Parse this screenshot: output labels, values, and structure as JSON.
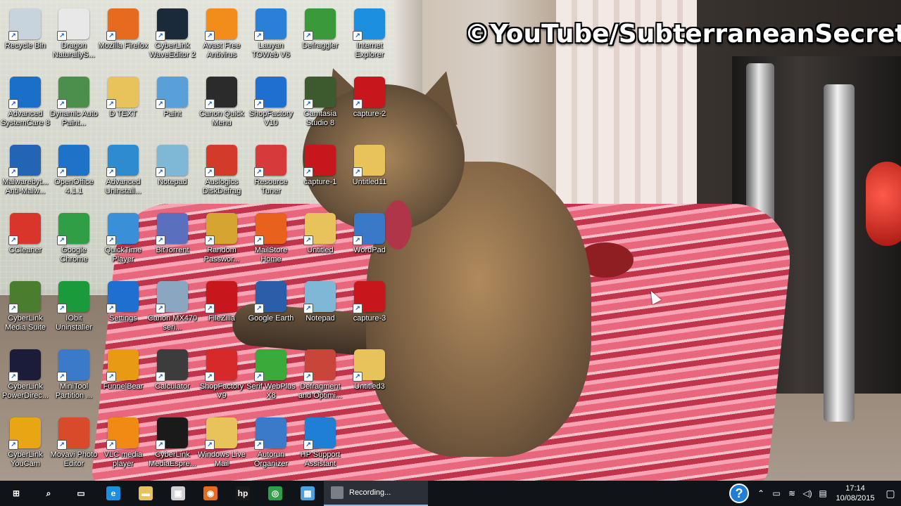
{
  "watermark": "©YouTube/SubterraneanSecret",
  "desktop_icons": [
    {
      "label": "Recycle Bin",
      "icon": "recycle-bin-icon",
      "color": "#c7d4de"
    },
    {
      "label": "Dragon NaturallyS...",
      "icon": "dragon-icon",
      "color": "#e8e8e8"
    },
    {
      "label": "Mozilla Firefox",
      "icon": "firefox-icon",
      "color": "#e66b1e"
    },
    {
      "label": "CyberLink WaveEditor 2",
      "icon": "waveeditor-icon",
      "color": "#1b2a3a"
    },
    {
      "label": "Avast Free Antivirus",
      "icon": "avast-icon",
      "color": "#f28c1a"
    },
    {
      "label": "Lauyan TOWeb V6",
      "icon": "toweb-icon",
      "color": "#2a7fd6"
    },
    {
      "label": "Defraggler",
      "icon": "defraggler-icon",
      "color": "#3a9a3a"
    },
    {
      "label": "Internet Explorer",
      "icon": "internet-explorer-icon",
      "color": "#1d8fe1"
    },
    {
      "label": "Advanced SystemCare 8",
      "icon": "systemcare-icon",
      "color": "#1a6fc9"
    },
    {
      "label": "Dynamic Auto Paint...",
      "icon": "autopaint-icon",
      "color": "#4b8f4b"
    },
    {
      "label": "D TEXT",
      "icon": "folder-icon",
      "color": "#e8c25a"
    },
    {
      "label": "Paint",
      "icon": "paint-icon",
      "color": "#5aa0d8"
    },
    {
      "label": "Canon Quick Menu",
      "icon": "canon-quick-menu-icon",
      "color": "#2b2b2b"
    },
    {
      "label": "ShopFactory V10",
      "icon": "shopfactory-icon",
      "color": "#1f6fd1"
    },
    {
      "label": "Camtasia Studio 8",
      "icon": "camtasia-icon",
      "color": "#3d5a2f"
    },
    {
      "label": "capture-2",
      "icon": "video-file-icon",
      "color": "#c8161d"
    },
    {
      "label": "Malwarebyt... Anti-Malw...",
      "icon": "malwarebytes-icon",
      "color": "#2464b4"
    },
    {
      "label": "OpenOffice 4.1.1",
      "icon": "openoffice-icon",
      "color": "#1e72c8"
    },
    {
      "label": "Advanced Uninstall...",
      "icon": "uninstaller-icon",
      "color": "#2e8bd0"
    },
    {
      "label": "Notepad",
      "icon": "notepad-icon",
      "color": "#7fb8d6"
    },
    {
      "label": "Auslogics DiskDefrag",
      "icon": "diskdefrag-icon",
      "color": "#d43a2a"
    },
    {
      "label": "Resource Tuner",
      "icon": "resource-tuner-icon",
      "color": "#d63a3a"
    },
    {
      "label": "capture-1",
      "icon": "video-file-icon",
      "color": "#c8161d"
    },
    {
      "label": "Untitled11",
      "icon": "folder-icon",
      "color": "#e8c25a"
    },
    {
      "label": "CCleaner",
      "icon": "ccleaner-icon",
      "color": "#d9352a"
    },
    {
      "label": "Google Chrome",
      "icon": "chrome-icon",
      "color": "#2f9e44"
    },
    {
      "label": "QuickTime Player",
      "icon": "quicktime-icon",
      "color": "#3a8fd9"
    },
    {
      "label": "BitTorrent",
      "icon": "bittorrent-icon",
      "color": "#5a6fbe"
    },
    {
      "label": "Random Passwor...",
      "icon": "password-icon",
      "color": "#d6a431"
    },
    {
      "label": "MailStore Home",
      "icon": "mailstore-icon",
      "color": "#e8621e"
    },
    {
      "label": "Untitled",
      "icon": "folder-icon",
      "color": "#e8c25a"
    },
    {
      "label": "WordPad",
      "icon": "wordpad-icon",
      "color": "#3a78c8"
    },
    {
      "label": "CyberLink Media Suite",
      "icon": "media-suite-icon",
      "color": "#4b7d2e"
    },
    {
      "label": "IObit Uninstaller",
      "icon": "iobit-icon",
      "color": "#1a9a3a"
    },
    {
      "label": "Settings",
      "icon": "gear-icon",
      "color": "#1f6fd1"
    },
    {
      "label": "Canon MX470 seri...",
      "icon": "canon-printer-icon",
      "color": "#8aa6c0"
    },
    {
      "label": "FileZilla",
      "icon": "filezilla-icon",
      "color": "#c8161d"
    },
    {
      "label": "Google Earth",
      "icon": "google-earth-icon",
      "color": "#2b5ea8"
    },
    {
      "label": "Notepad",
      "icon": "notepad-icon",
      "color": "#7fb8d6"
    },
    {
      "label": "capture-3",
      "icon": "video-file-icon",
      "color": "#c8161d"
    },
    {
      "label": "CyberLink PowerDirec...",
      "icon": "powerdirector-icon",
      "color": "#1b1b3a"
    },
    {
      "label": "MiniTool Partition ...",
      "icon": "minitool-icon",
      "color": "#3a7ac8"
    },
    {
      "label": "FunnelBear",
      "icon": "funnelbear-icon",
      "color": "#e89a14"
    },
    {
      "label": "Calculator",
      "icon": "calculator-icon",
      "color": "#3c3c3c"
    },
    {
      "label": "ShopFactory V9",
      "icon": "shopfactory-icon",
      "color": "#d62a2a"
    },
    {
      "label": "Serif WebPlus X8",
      "icon": "webplus-icon",
      "color": "#3aaa3a"
    },
    {
      "label": "Defragment and Optimi...",
      "icon": "defragment-icon",
      "color": "#c8453a"
    },
    {
      "label": "Untitled3",
      "icon": "folder-icon",
      "color": "#e8c25a"
    },
    {
      "label": "CyberLink YouCam",
      "icon": "youcam-icon",
      "color": "#e8a514"
    },
    {
      "label": "Movavi Photo Editor",
      "icon": "movavi-icon",
      "color": "#d84a2a"
    },
    {
      "label": "VLC media player",
      "icon": "vlc-icon",
      "color": "#f08a14"
    },
    {
      "label": "CyberLink MediaEspre...",
      "icon": "mediaespresso-icon",
      "color": "#1a1a1a"
    },
    {
      "label": "Windows Live Mail",
      "icon": "live-mail-icon",
      "color": "#e8c25a"
    },
    {
      "label": "Autorun Organizer",
      "icon": "autorun-icon",
      "color": "#3a7ac8"
    },
    {
      "label": "HP Support Assistant",
      "icon": "help-icon",
      "color": "#1f7ed6"
    }
  ],
  "taskbar": {
    "pinned": [
      {
        "name": "start-button",
        "icon": "windows-icon",
        "glyph": "⊞",
        "color": "#101418"
      },
      {
        "name": "search-button",
        "icon": "search-icon",
        "glyph": "⌕",
        "color": "#101418"
      },
      {
        "name": "task-view-button",
        "icon": "task-view-icon",
        "glyph": "▭",
        "color": "#101418"
      },
      {
        "name": "edge-button",
        "icon": "edge-icon",
        "glyph": "e",
        "color": "#1d8fe1"
      },
      {
        "name": "file-explorer-button",
        "icon": "folder-icon",
        "glyph": "▬",
        "color": "#e8c25a"
      },
      {
        "name": "store-button",
        "icon": "store-icon",
        "glyph": "▣",
        "color": "#d0d0d0"
      },
      {
        "name": "firefox-button",
        "icon": "firefox-icon",
        "glyph": "◉",
        "color": "#e66b1e"
      },
      {
        "name": "hp-button",
        "icon": "hp-icon",
        "glyph": "hp",
        "color": "#1a1a1a"
      },
      {
        "name": "chrome-button",
        "icon": "chrome-icon",
        "glyph": "◎",
        "color": "#2f9e44"
      },
      {
        "name": "app-button",
        "icon": "window-icon",
        "glyph": "▦",
        "color": "#4aa3df"
      }
    ],
    "active_window": "Recording...",
    "clock_time": "17:14",
    "clock_date": "10/08/2015"
  }
}
